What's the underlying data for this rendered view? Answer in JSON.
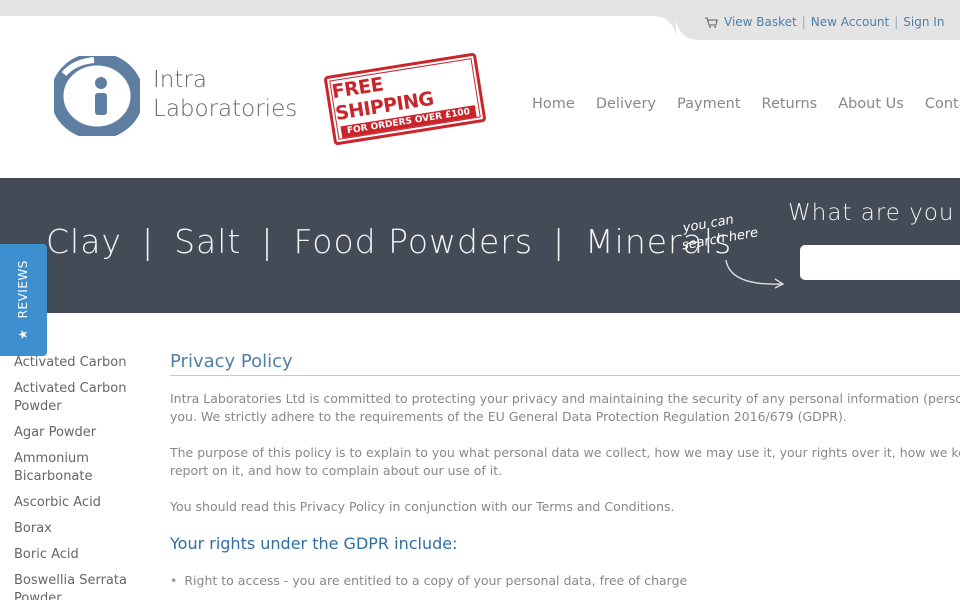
{
  "account": {
    "basket": "View Basket",
    "new_account": "New Account",
    "sign_in": "Sign In",
    "separator": "|"
  },
  "logo": {
    "line1": "Intra",
    "line2": "Laboratories"
  },
  "stamp": {
    "main": "FREE SHIPPING",
    "sub": "FOR ORDERS OVER £100"
  },
  "nav": [
    "Home",
    "Delivery",
    "Payment",
    "Returns",
    "About Us",
    "Contact"
  ],
  "banner": {
    "categories": [
      "Clay",
      "Salt",
      "Food Powders",
      "Minerals"
    ],
    "separator": "|",
    "hint_line1": "you can",
    "hint_line2": "search here",
    "search_title": "What are you l",
    "search_placeholder": ""
  },
  "reviews": {
    "label": "REVIEWS",
    "star": "★"
  },
  "sidebar": [
    "Activated Carbon",
    "Activated Carbon Powder",
    "Agar Powder",
    "Ammonium Bicarbonate",
    "Ascorbic Acid",
    "Borax",
    "Boric Acid",
    "Boswellia Serrata Powder"
  ],
  "content": {
    "title": "Privacy Policy",
    "p1_line1": "Intra Laboratories Ltd is committed to protecting your privacy and maintaining the security of any personal information (personal d",
    "p1_line2": "you. We strictly adhere to the requirements of the EU General Data Protection Regulation 2016/679 (GDPR).",
    "p2_line1": "The purpose of this policy is to explain to you what personal data we collect, how we may use it, your rights over it, how we keep it",
    "p2_line2": "report on it, and how to complain about our use of it.",
    "p3": "You should read this Privacy Policy in conjunction with our Terms and Conditions.",
    "rights_title": "Your rights under the GDPR include:",
    "bullets": [
      "Right to access - you are entitled to a copy of your personal data, free of charge"
    ]
  },
  "colors": {
    "link": "#4f7fa8",
    "banner": "#434b57",
    "reviews": "#3d8fd0",
    "stamp": "#c9262c"
  }
}
